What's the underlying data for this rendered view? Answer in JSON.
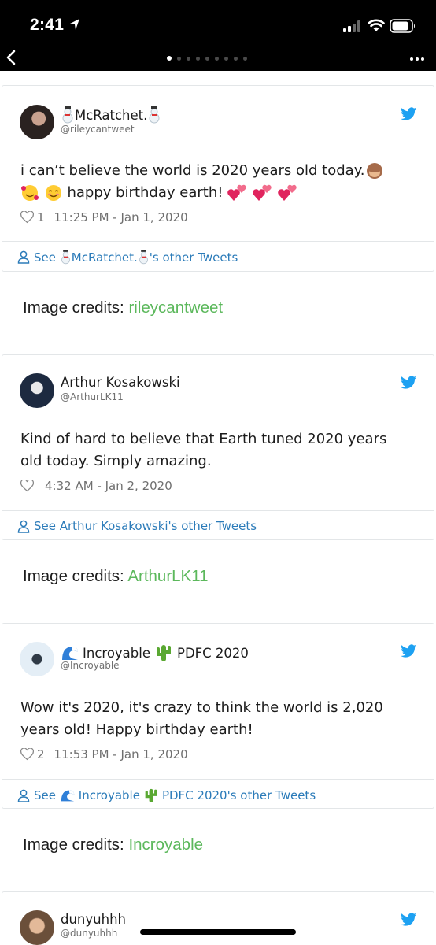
{
  "status_bar": {
    "time": "2:41"
  },
  "nav": {
    "page_count": 9,
    "active_page": 0
  },
  "tweets": [
    {
      "display_name": "McRatchet.",
      "handle": "@rileycantweet",
      "text_line1": "i can’t believe the world is 2020 years old today.",
      "text_line2": "happy birthday earth!",
      "likes": "1",
      "timestamp": "11:25 PM - Jan 1, 2020",
      "footer_prefix": "See",
      "footer_name": "McRatchet.",
      "footer_suffix": "'s other Tweets",
      "credit_label": "Image credits:",
      "credit_source": "rileycantweet"
    },
    {
      "display_name": "Arthur Kosakowski",
      "handle": "@ArthurLK11",
      "text_line1": "Kind of hard to believe that Earth tuned 2020 years",
      "text_line2": "old today. Simply amazing.",
      "likes": "",
      "timestamp": "4:32 AM - Jan 2, 2020",
      "footer_prefix": "See Arthur Kosakowski's other Tweets",
      "credit_label": "Image credits:",
      "credit_source": "ArthurLK11"
    },
    {
      "display_name_a": "Incroyable",
      "display_name_b": "PDFC 2020",
      "handle": "@Incroyable",
      "text_line1": "Wow it's 2020, it's crazy to think the world is 2,020",
      "text_line2": "years old! Happy birthday earth!",
      "likes": "2",
      "timestamp": "11:53 PM - Jan 1, 2020",
      "footer_prefix": "See",
      "footer_name_a": "Incroyable",
      "footer_name_b": "PDFC 2020's other Tweets",
      "credit_label": "Image credits:",
      "credit_source": "Incroyable"
    },
    {
      "display_name": "dunyuhhh",
      "handle": "@dunyuhhh"
    }
  ],
  "colors": {
    "twitter_blue": "#1da1f2",
    "link_blue": "#2b7bb9",
    "credit_green": "#5cb85c",
    "like_pink": "#e0245e"
  }
}
